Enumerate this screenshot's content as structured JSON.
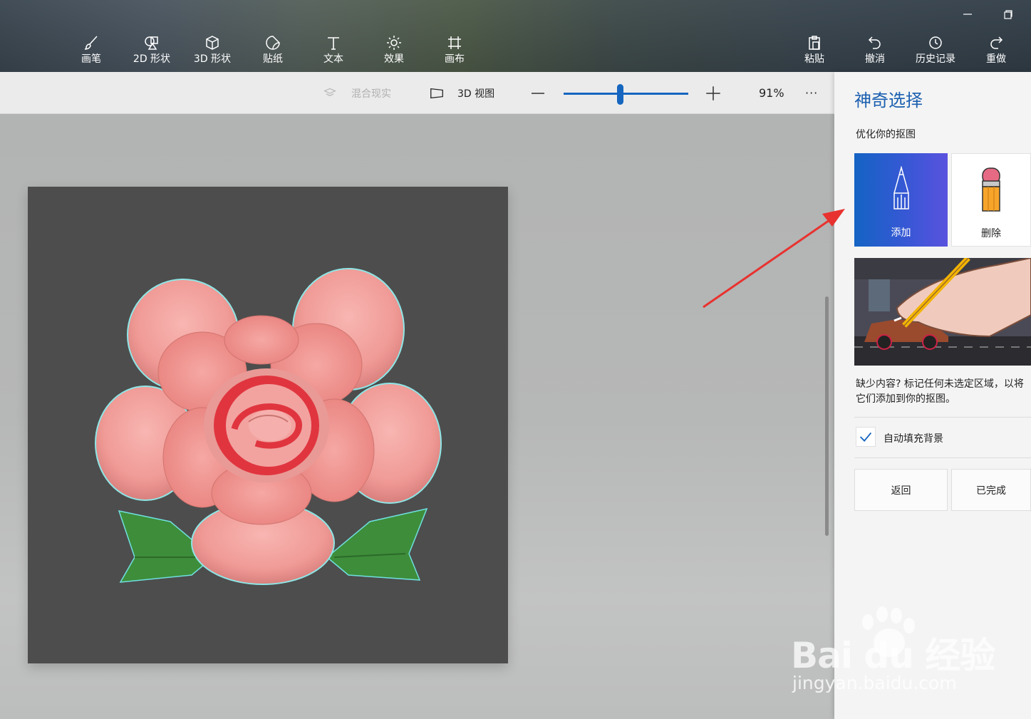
{
  "toolbar": {
    "tools": [
      {
        "label": "画笔",
        "icon": "brush-icon"
      },
      {
        "label": "2D 形状",
        "icon": "shapes-2d-icon"
      },
      {
        "label": "3D 形状",
        "icon": "cube-icon"
      },
      {
        "label": "贴纸",
        "icon": "sticker-icon"
      },
      {
        "label": "文本",
        "icon": "text-icon"
      },
      {
        "label": "效果",
        "icon": "effects-sun-icon"
      },
      {
        "label": "画布",
        "icon": "canvas-crop-icon"
      }
    ],
    "actions": [
      {
        "label": "粘贴",
        "icon": "paste-icon"
      },
      {
        "label": "撤消",
        "icon": "undo-icon"
      },
      {
        "label": "历史记录",
        "icon": "history-icon"
      },
      {
        "label": "重做",
        "icon": "redo-icon"
      }
    ]
  },
  "subbar": {
    "mixed_reality": "混合现实",
    "view_3d": "3D 视图",
    "zoom_value": "91%",
    "zoom_slider_level": 0.45,
    "more": "···"
  },
  "panel": {
    "title": "神奇选择",
    "subtitle": "优化你的抠图",
    "add_label": "添加",
    "remove_label": "删除",
    "description": "缺少内容? 标记任何未选定区域，以将它们添加到你的抠图。",
    "auto_fill_label": "自动填充背景",
    "auto_fill_checked": true,
    "back_label": "返回",
    "done_label": "已完成"
  },
  "colors": {
    "accent": "#1666c0",
    "panel_title": "#1b5fb0",
    "annotation_arrow": "#e8322f"
  },
  "watermark": {
    "brand": "Bai du 经验",
    "url": "jingyan.baidu.com"
  }
}
